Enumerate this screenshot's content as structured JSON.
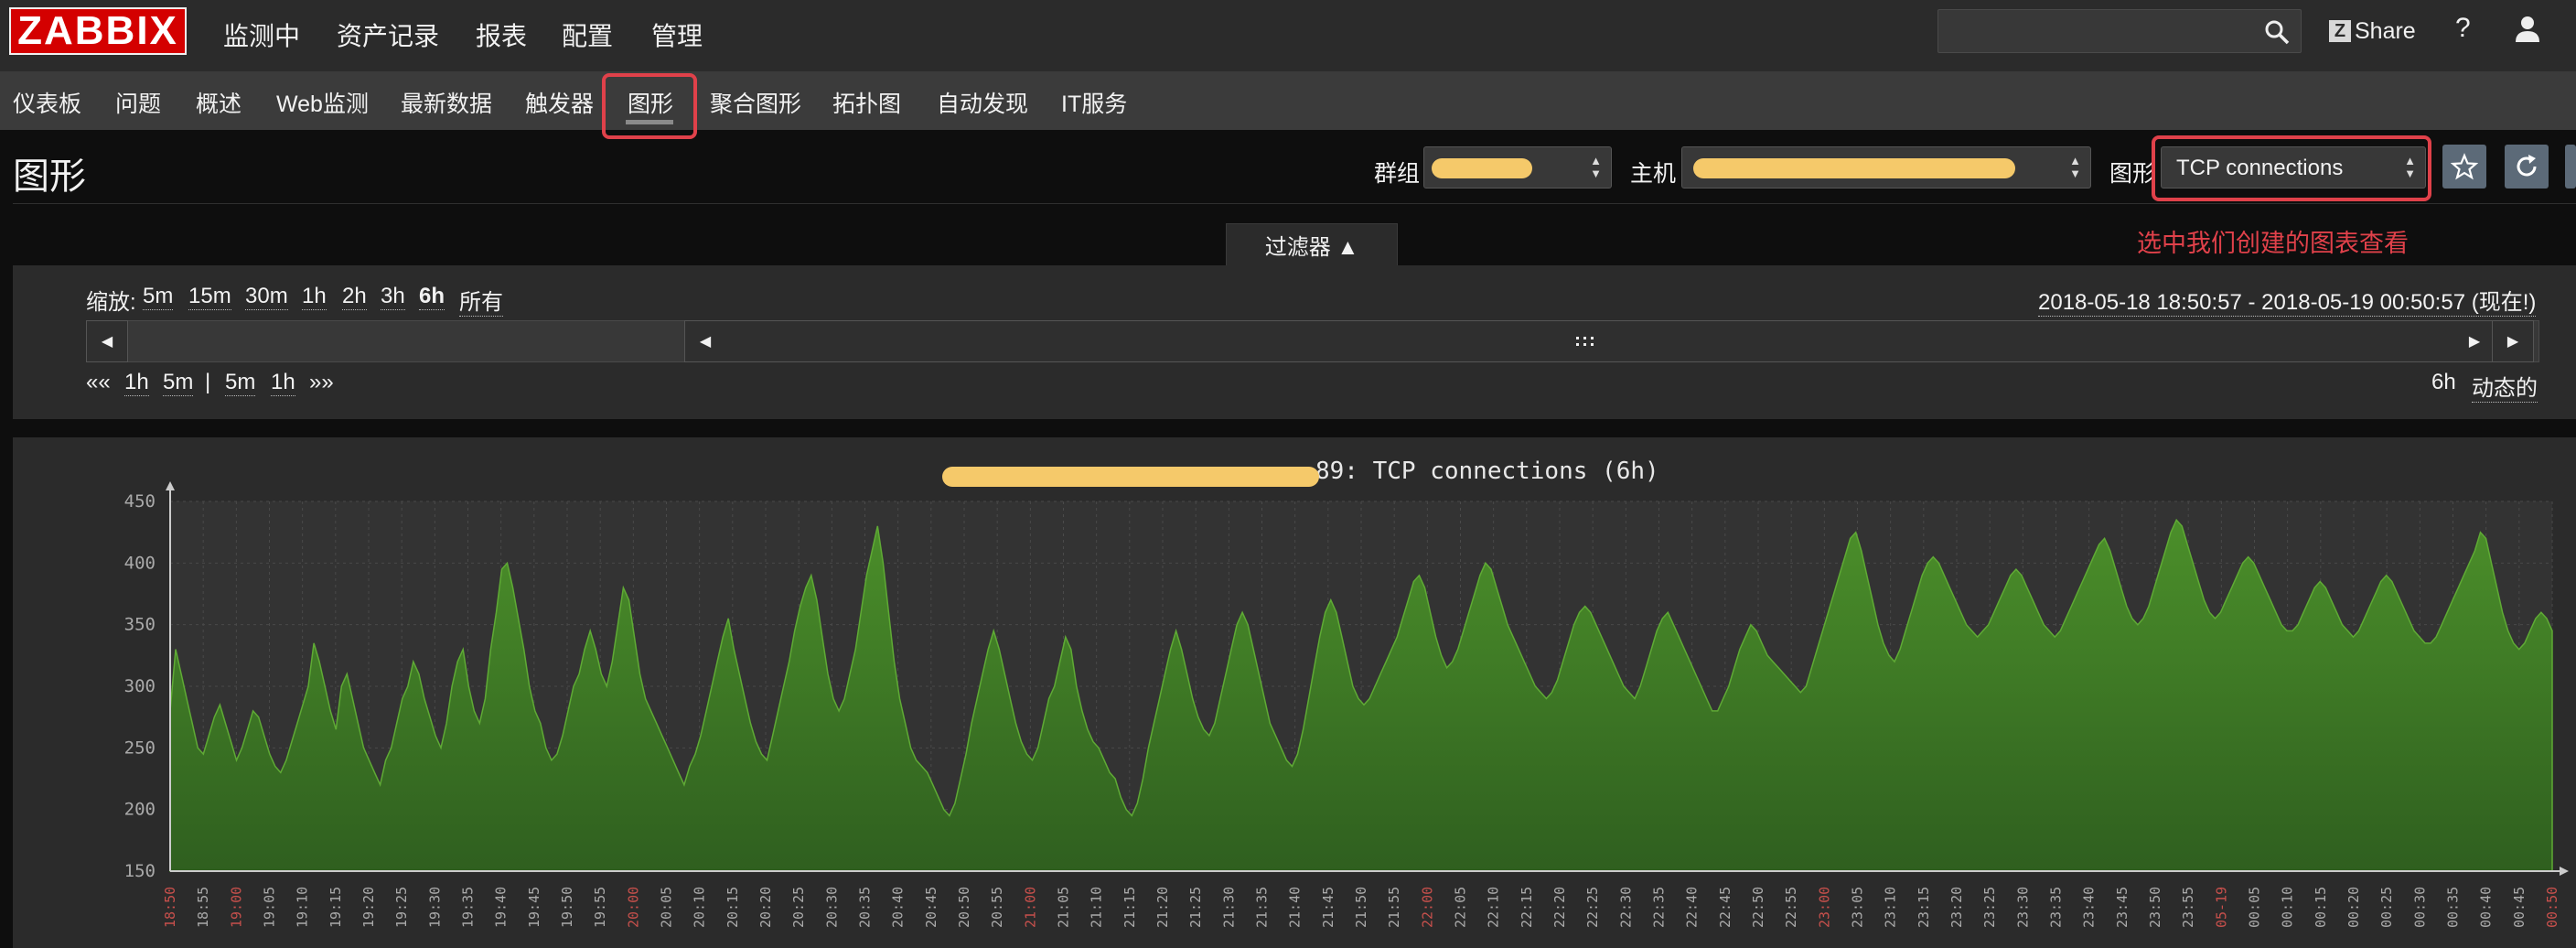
{
  "topbar": {
    "logo": "ZABBIX",
    "menu": [
      "监测中",
      "资产记录",
      "报表",
      "配置",
      "管理"
    ],
    "share_label": "Share",
    "help_label": "?"
  },
  "submenu": {
    "items": [
      "仪表板",
      "问题",
      "概述",
      "Web监测",
      "最新数据",
      "触发器",
      "图形",
      "聚合图形",
      "拓扑图",
      "自动发现",
      "IT服务"
    ],
    "active": "图形"
  },
  "header": {
    "title": "图形",
    "group_label": "群组",
    "host_label": "主机",
    "graph_label": "图形",
    "graph_value": "TCP connections",
    "annotation": "选中我们创建的图表查看"
  },
  "filter": {
    "tab_label": "过滤器 ▲",
    "zoom_label": "缩放:",
    "zoom_options": [
      "5m",
      "15m",
      "30m",
      "1h",
      "2h",
      "3h",
      "6h",
      "所有"
    ],
    "zoom_active": "6h",
    "time_range": "2018-05-18 18:50:57 - 2018-05-19 00:50:57 (现在!)",
    "nav_left": [
      "««",
      "1h",
      "5m",
      "|",
      "5m",
      "1h",
      "»»"
    ],
    "period": "6h",
    "dynamic_label": "动态的"
  },
  "graph": {
    "title_suffix": ".89: TCP connections (6h)"
  },
  "chart_data": {
    "type": "area",
    "ylim": [
      150,
      450
    ],
    "yticks": [
      150,
      200,
      250,
      300,
      350,
      400,
      450
    ],
    "x_tick_labels": [
      "18:50",
      "18:55",
      "19:00",
      "19:05",
      "19:10",
      "19:15",
      "19:20",
      "19:25",
      "19:30",
      "19:35",
      "19:40",
      "19:45",
      "19:50",
      "19:55",
      "20:00",
      "20:05",
      "20:10",
      "20:15",
      "20:20",
      "20:25",
      "20:30",
      "20:35",
      "20:40",
      "20:45",
      "20:50",
      "20:55",
      "21:00",
      "21:05",
      "21:10",
      "21:15",
      "21:20",
      "21:25",
      "21:30",
      "21:35",
      "21:40",
      "21:45",
      "21:50",
      "21:55",
      "22:00",
      "22:05",
      "22:10",
      "22:15",
      "22:20",
      "22:25",
      "22:30",
      "22:35",
      "22:40",
      "22:45",
      "22:50",
      "22:55",
      "23:00",
      "23:05",
      "23:10",
      "23:15",
      "23:20",
      "23:25",
      "23:30",
      "23:35",
      "23:40",
      "23:45",
      "23:50",
      "23:55",
      "05-19",
      "00:05",
      "00:10",
      "00:15",
      "00:20",
      "00:25",
      "00:30",
      "00:35",
      "00:40",
      "00:45",
      "00:50"
    ],
    "x_tick_highlight": [
      "18:50",
      "19:00",
      "20:00",
      "21:00",
      "22:00",
      "23:00",
      "05-19",
      "00:50"
    ],
    "series": [
      {
        "values": [
          280,
          330,
          310,
          290,
          270,
          250,
          245,
          260,
          275,
          285,
          270,
          255,
          240,
          250,
          265,
          280,
          275,
          260,
          245,
          235,
          230,
          240,
          255,
          270,
          285,
          300,
          335,
          320,
          300,
          280,
          265,
          300,
          310,
          290,
          270,
          250,
          240,
          230,
          220,
          240,
          250,
          270,
          290,
          300,
          320,
          310,
          290,
          275,
          260,
          250,
          270,
          300,
          320,
          330,
          300,
          280,
          270,
          290,
          330,
          360,
          395,
          400,
          380,
          355,
          330,
          300,
          280,
          270,
          250,
          240,
          245,
          260,
          280,
          300,
          310,
          330,
          345,
          330,
          310,
          300,
          320,
          350,
          380,
          370,
          340,
          310,
          290,
          280,
          270,
          260,
          250,
          240,
          230,
          220,
          235,
          245,
          260,
          280,
          300,
          320,
          340,
          355,
          330,
          310,
          290,
          270,
          255,
          245,
          240,
          260,
          280,
          300,
          320,
          345,
          365,
          380,
          390,
          370,
          340,
          310,
          290,
          280,
          290,
          310,
          330,
          360,
          390,
          410,
          430,
          400,
          360,
          320,
          290,
          270,
          250,
          240,
          235,
          230,
          220,
          210,
          200,
          195,
          205,
          225,
          245,
          270,
          290,
          310,
          330,
          345,
          330,
          310,
          290,
          270,
          255,
          245,
          240,
          250,
          270,
          290,
          300,
          320,
          340,
          330,
          300,
          280,
          265,
          255,
          250,
          240,
          230,
          225,
          210,
          200,
          195,
          205,
          225,
          250,
          270,
          290,
          310,
          330,
          345,
          330,
          310,
          290,
          275,
          265,
          260,
          270,
          290,
          310,
          330,
          350,
          360,
          350,
          330,
          310,
          290,
          270,
          260,
          250,
          240,
          235,
          245,
          265,
          290,
          315,
          340,
          360,
          370,
          360,
          340,
          320,
          300,
          290,
          285,
          290,
          300,
          310,
          320,
          330,
          340,
          355,
          370,
          385,
          390,
          380,
          360,
          340,
          325,
          315,
          320,
          330,
          345,
          360,
          375,
          390,
          400,
          395,
          380,
          365,
          350,
          340,
          330,
          320,
          310,
          300,
          295,
          290,
          295,
          305,
          320,
          335,
          350,
          360,
          365,
          360,
          350,
          340,
          330,
          320,
          310,
          300,
          295,
          290,
          300,
          315,
          330,
          345,
          355,
          360,
          350,
          340,
          330,
          320,
          310,
          300,
          290,
          280,
          280,
          290,
          300,
          315,
          330,
          340,
          350,
          345,
          335,
          325,
          320,
          315,
          310,
          305,
          300,
          295,
          300,
          315,
          330,
          345,
          360,
          375,
          390,
          405,
          420,
          425,
          410,
          390,
          370,
          350,
          335,
          325,
          320,
          330,
          345,
          360,
          375,
          390,
          400,
          405,
          400,
          390,
          380,
          370,
          360,
          350,
          345,
          340,
          345,
          350,
          360,
          370,
          380,
          390,
          395,
          390,
          380,
          370,
          360,
          350,
          345,
          340,
          345,
          355,
          365,
          375,
          385,
          395,
          405,
          415,
          420,
          410,
          395,
          380,
          365,
          355,
          350,
          355,
          365,
          380,
          395,
          410,
          425,
          435,
          430,
          415,
          400,
          385,
          370,
          360,
          355,
          360,
          370,
          380,
          390,
          400,
          405,
          400,
          390,
          380,
          370,
          360,
          350,
          345,
          345,
          350,
          360,
          370,
          380,
          385,
          380,
          370,
          360,
          350,
          345,
          340,
          345,
          355,
          365,
          375,
          385,
          390,
          385,
          375,
          365,
          355,
          345,
          340,
          335,
          335,
          340,
          350,
          360,
          370,
          380,
          390,
          400,
          410,
          425,
          420,
          400,
          380,
          360,
          345,
          335,
          330,
          335,
          345,
          355,
          360,
          355,
          345
        ]
      }
    ]
  }
}
